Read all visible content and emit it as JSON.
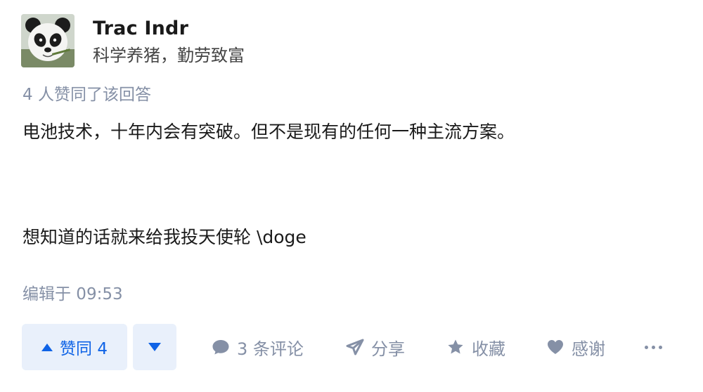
{
  "author": {
    "name": "Trac Indr",
    "bio": "科学养猪，勤劳致富",
    "avatar_icon": "panda-avatar"
  },
  "vote_summary": "4 人赞同了该回答",
  "answer": {
    "paragraphs": [
      "电池技术，十年内会有突破。但不是现有的任何一种主流方案。",
      "想知道的话就来给我投天使轮 \\doge"
    ]
  },
  "edited": "编辑于 09:53",
  "actions": {
    "upvote_label": "赞同 4",
    "comments_label": "3 条评论",
    "share_label": "分享",
    "favorite_label": "收藏",
    "thanks_label": "感谢"
  },
  "colors": {
    "accent": "#0f63e6",
    "vote_bg": "#e9f0fb",
    "muted": "#8590a6",
    "text": "#1a1a1a"
  }
}
